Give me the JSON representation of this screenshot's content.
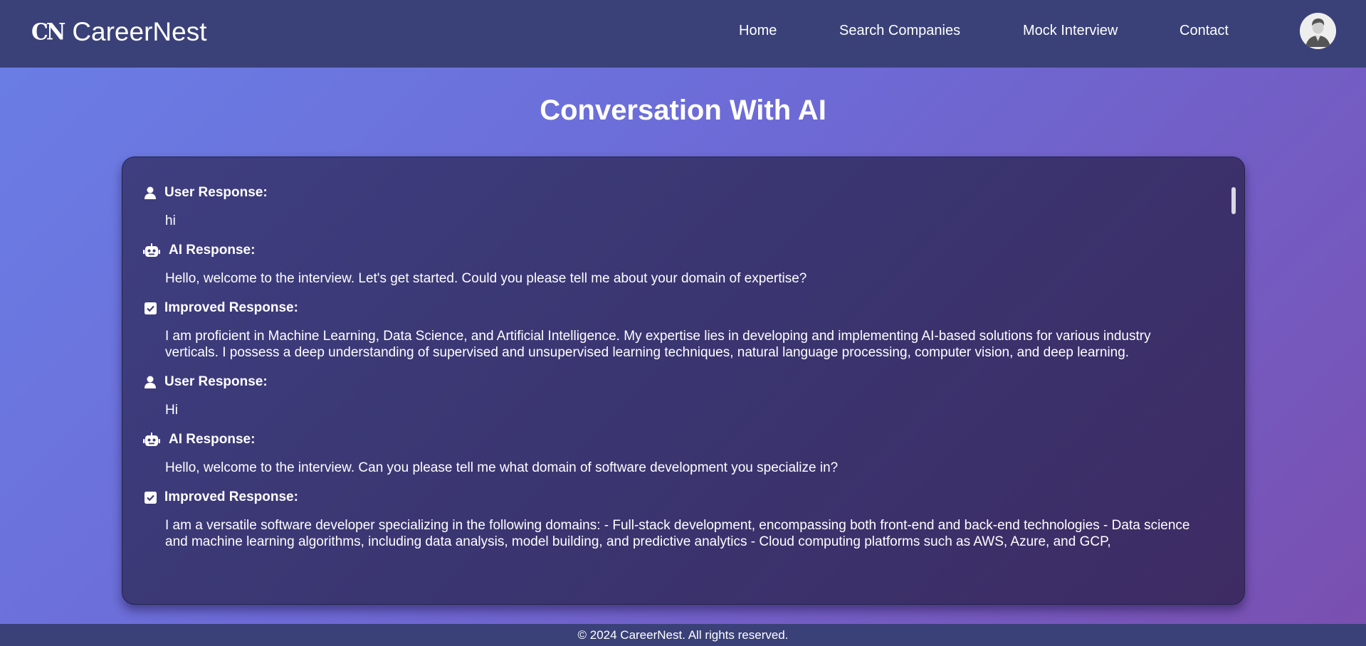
{
  "nav": {
    "logo_mark": "CN",
    "brand": "CareerNest",
    "links": [
      "Home",
      "Search Companies",
      "Mock Interview",
      "Contact"
    ]
  },
  "page": {
    "title": "Conversation With AI"
  },
  "conversation": [
    {
      "label": "User Response:",
      "icon": "user-icon",
      "text": "hi"
    },
    {
      "label": "AI Response:",
      "icon": "robot-icon",
      "text": "Hello, welcome to the interview. Let's get started. Could you please tell me about your domain of expertise?"
    },
    {
      "label": "Improved Response:",
      "icon": "checkbox-icon",
      "text": "I am proficient in Machine Learning, Data Science, and Artificial Intelligence. My expertise lies in developing and implementing AI-based solutions for various industry verticals. I possess a deep understanding of supervised and unsupervised learning techniques, natural language processing, computer vision, and deep learning."
    },
    {
      "label": "User Response:",
      "icon": "user-icon",
      "text": "Hi"
    },
    {
      "label": "AI Response:",
      "icon": "robot-icon",
      "text": "Hello, welcome to the interview. Can you please tell me what domain of software development you specialize in?"
    },
    {
      "label": "Improved Response:",
      "icon": "checkbox-icon",
      "text": "I am a versatile software developer specializing in the following domains: - Full-stack development, encompassing both front-end and back-end technologies - Data science and machine learning algorithms, including data analysis, model building, and predictive analytics - Cloud computing platforms such as AWS, Azure, and GCP,"
    }
  ],
  "footer": {
    "text": "© 2024 CareerNest. All rights reserved."
  }
}
